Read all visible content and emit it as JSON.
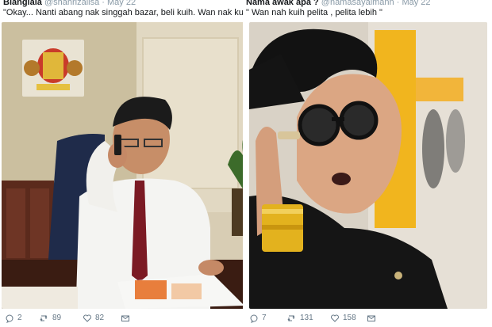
{
  "tweets": [
    {
      "name": "Bianglala",
      "handle": "@shahrizailsa",
      "date": "May 22",
      "text": "\"Okay... Nanti abang nak singgah bazar, beli kuih. Wan nak kuih apa?\"",
      "replies": "2",
      "retweets": "89",
      "likes": "82",
      "photo_subject": "man on phone at office desk"
    },
    {
      "name": "Nama awak apa ?",
      "handle": "@namasayaimann",
      "date": "May 22",
      "text": "\" Wan nah kuih pelita , pelita lebih \"",
      "replies": "7",
      "retweets": "131",
      "likes": "158",
      "photo_subject": "man with large round glasses"
    }
  ],
  "icons": {
    "reply": "reply-icon",
    "retweet": "retweet-icon",
    "like": "heart-icon",
    "message": "envelope-icon"
  },
  "colors": {
    "text": "#14171a",
    "muted": "#657786",
    "handle": "#8899a6"
  }
}
